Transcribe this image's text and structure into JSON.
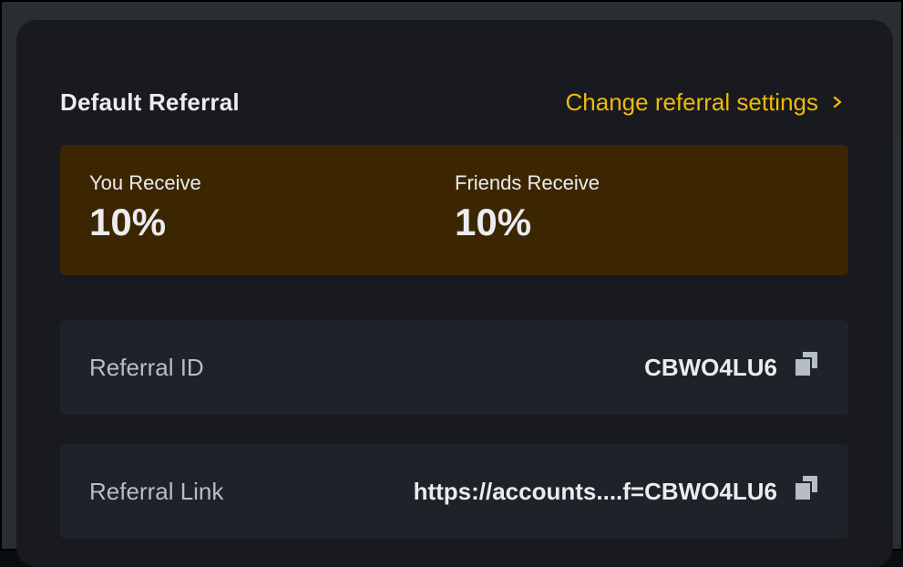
{
  "header": {
    "title": "Default Referral",
    "change_link_label": "Change referral settings",
    "change_link_icon": "chevron-right-icon"
  },
  "rates": {
    "you_receive": {
      "label": "You Receive",
      "value": "10%"
    },
    "friends_receive": {
      "label": "Friends Receive",
      "value": "10%"
    },
    "background_color": "#3c2601"
  },
  "referral_id": {
    "label": "Referral ID",
    "value": "CBWO4LU6",
    "copy_icon": "copy-icon"
  },
  "referral_link": {
    "label": "Referral Link",
    "value": "https://accounts....f=CBWO4LU6",
    "copy_icon": "copy-icon"
  },
  "colors": {
    "accent": "#f0b90b",
    "card_background": "#181a20",
    "row_background": "#1e2329",
    "primary_text": "#eaecef",
    "secondary_text": "#b7bdc6"
  }
}
